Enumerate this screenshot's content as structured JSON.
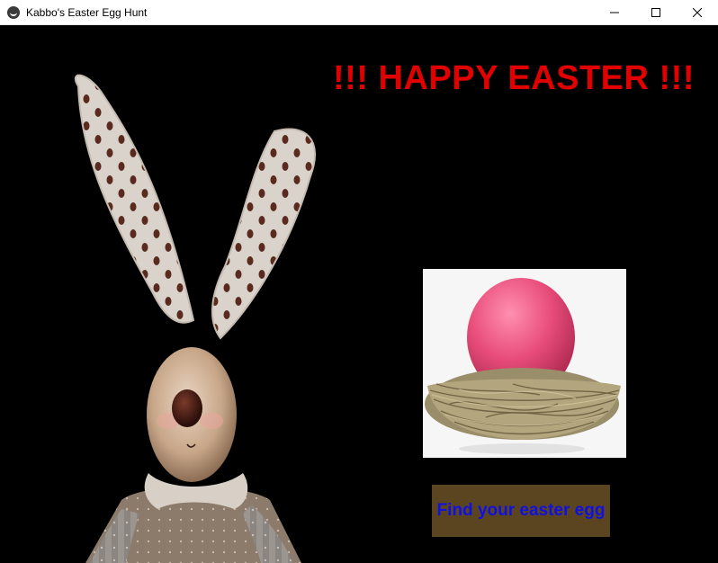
{
  "window": {
    "title": "Kabbo's Easter Egg Hunt",
    "controls": [
      "minimize",
      "maximize",
      "close"
    ]
  },
  "main": {
    "headline": "!!! HAPPY EASTER !!!",
    "find_button_label": "Find your easter egg"
  },
  "images": {
    "bunny": "easter-bunny-photo",
    "egg": "pink-egg-in-nest-photo"
  },
  "colors": {
    "background": "#000000",
    "headline": "#e00000",
    "button_bg": "#5a4520",
    "button_text": "#1010e0"
  }
}
